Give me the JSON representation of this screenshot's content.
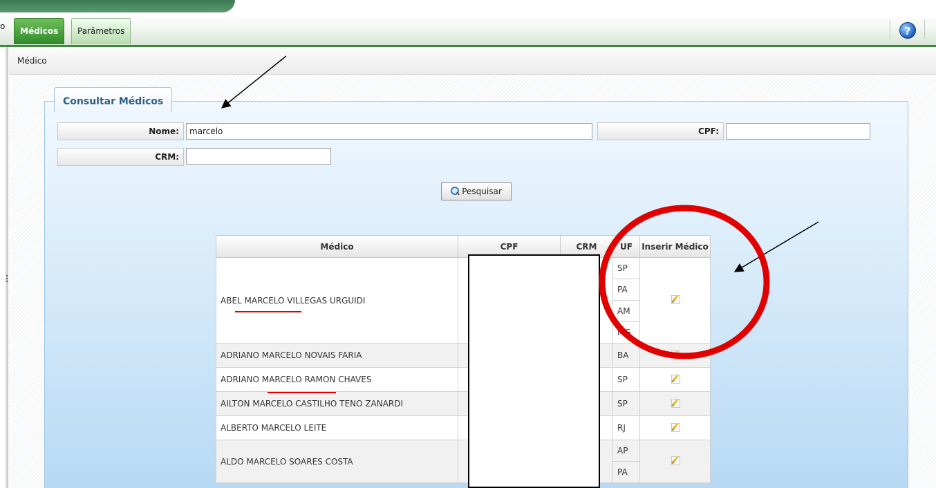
{
  "nav": {
    "partial_tab": "o",
    "tabs": [
      {
        "label": "Médicos",
        "active": true
      },
      {
        "label": "Parâmetros",
        "active": false
      }
    ],
    "help_icon": "help-icon"
  },
  "breadcrumb": "Médico",
  "panel": {
    "title": "Consultar Médicos",
    "fields": {
      "nome": {
        "label": "Nome:",
        "value": "marcelo"
      },
      "cpf": {
        "label": "CPF:",
        "value": ""
      },
      "crm": {
        "label": "CRM:",
        "value": ""
      }
    },
    "search_button": "Pesquisar"
  },
  "table": {
    "columns": [
      "Médico",
      "CPF",
      "CRM",
      "UF",
      "Inserir Médico"
    ],
    "rows": [
      {
        "name": "ABEL MARCELO VILLEGAS URGUIDI",
        "uf": [
          "SP",
          "PA",
          "AM",
          "MG"
        ]
      },
      {
        "name": "ADRIANO MARCELO NOVAIS FARIA",
        "uf": [
          "BA"
        ]
      },
      {
        "name": "ADRIANO MARCELO RAMON CHAVES",
        "uf": [
          "SP"
        ]
      },
      {
        "name": "AILTON MARCELO CASTILHO TENO ZANARDI",
        "uf": [
          "SP"
        ]
      },
      {
        "name": "ALBERTO MARCELO LEITE",
        "uf": [
          "RJ"
        ]
      },
      {
        "name": "ALDO MARCELO SOARES COSTA",
        "uf": [
          "AP",
          "PA"
        ]
      }
    ]
  },
  "colors": {
    "tab_active": "#2f8a2a",
    "annotation_red": "#e10000",
    "panel_blue": "#b8d9f4"
  }
}
